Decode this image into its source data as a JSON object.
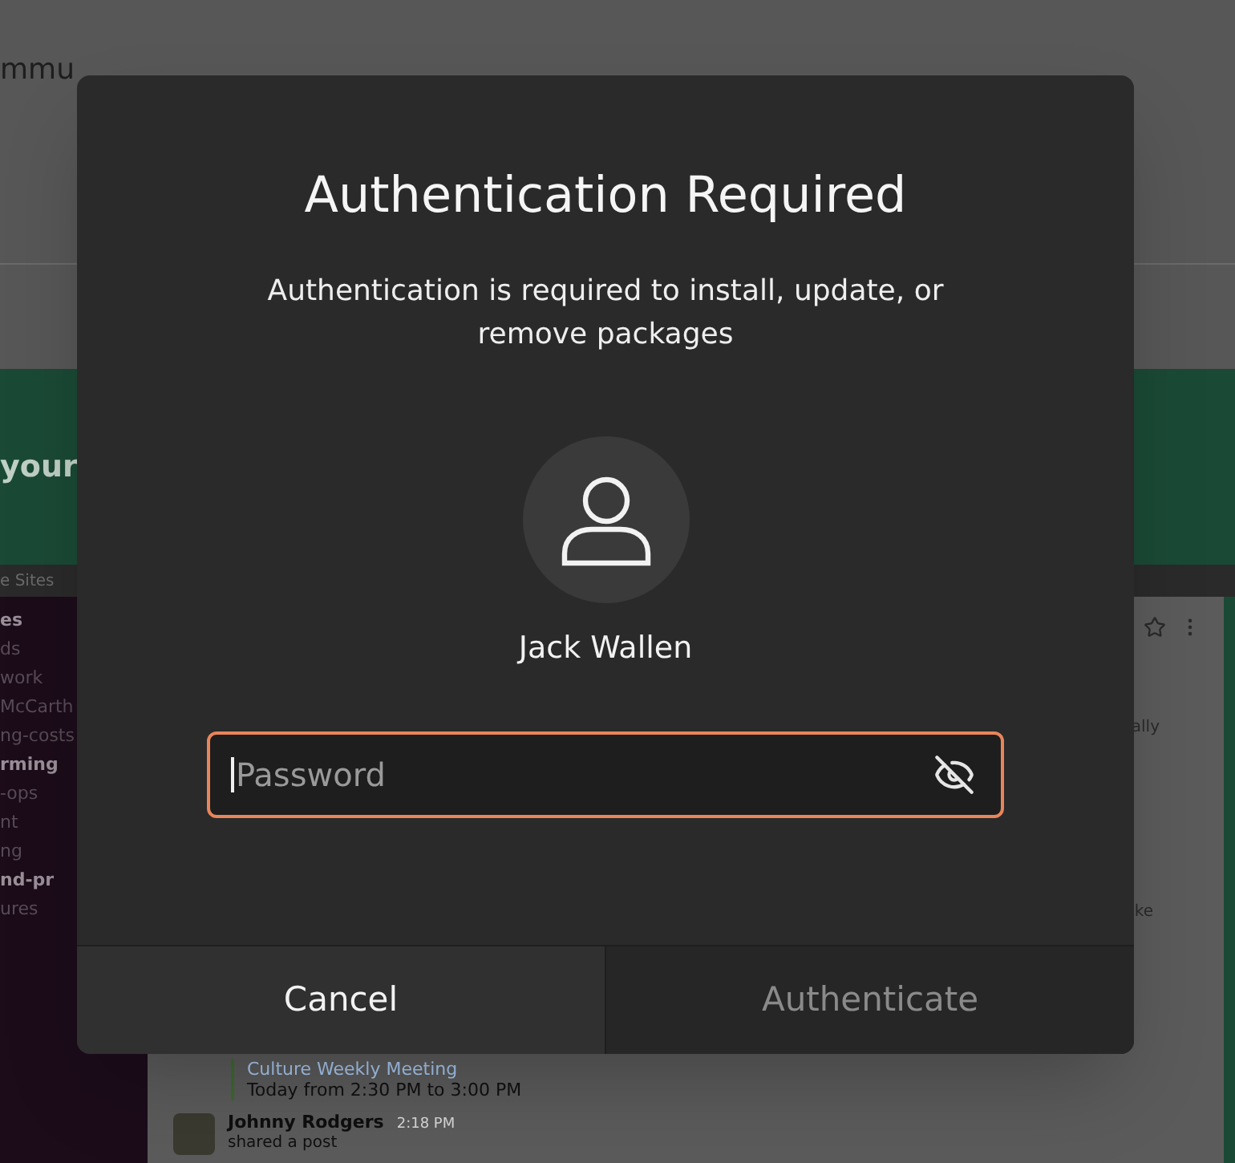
{
  "background": {
    "heading": "mmu",
    "banner_text": "your",
    "tab_text": "e Sites",
    "sidebar_items": [
      {
        "label": "es",
        "bold": true
      },
      {
        "label": "ds",
        "bold": false
      },
      {
        "label": "work",
        "bold": false
      },
      {
        "label": "McCarth",
        "bold": false
      },
      {
        "label": "ng-costs",
        "bold": false
      },
      {
        "label": "rming",
        "bold": true
      },
      {
        "label": "-ops",
        "bold": false
      },
      {
        "label": "nt",
        "bold": false
      },
      {
        "label": "ng",
        "bold": false
      },
      {
        "label": "nd-pr",
        "bold": true
      },
      {
        "label": "ures",
        "bold": false
      }
    ],
    "event": {
      "title": "Culture Weekly Meeting",
      "time": "Today from 2:30 PM to 3:00 PM"
    },
    "message": {
      "author": "Johnny Rodgers",
      "time": "2:18 PM",
      "text": "shared a post"
    },
    "right_fragments": [
      "ally",
      "ke"
    ]
  },
  "dialog": {
    "title": "Authentication Required",
    "message": "Authentication is required to install, update, or remove packages",
    "user_name": "Jack Wallen",
    "password_field": {
      "placeholder": "Password",
      "focused": true
    },
    "buttons": [
      {
        "label": "Cancel",
        "disabled": false
      },
      {
        "label": "Authenticate",
        "disabled": true
      }
    ]
  }
}
